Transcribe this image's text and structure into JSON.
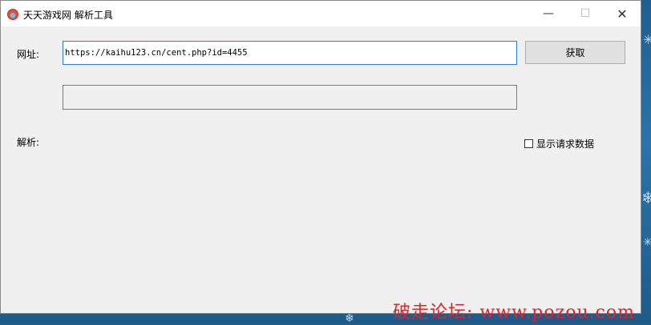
{
  "window": {
    "title": "天天游戏网 解析工具",
    "controls": {
      "minimize": "—",
      "maximize": "☐",
      "close": "✕"
    }
  },
  "form": {
    "url_label": "网址:",
    "url_value": "https://kaihu123.cn/cent.php?id=4455",
    "fetch_button": "获取",
    "parse_label": "解析:",
    "show_request_label": "显示请求数据",
    "show_request_checked": false
  },
  "watermark": "破走论坛: www.pozou.com",
  "colors": {
    "accent_border": "#2f7bd5",
    "watermark": "#e0232b"
  }
}
